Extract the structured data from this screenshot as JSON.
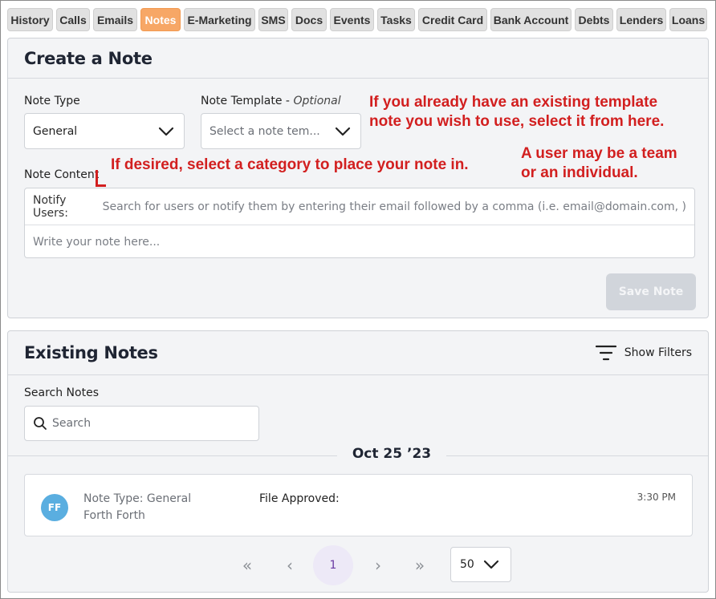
{
  "tabs": [
    {
      "label": "History"
    },
    {
      "label": "Calls"
    },
    {
      "label": "Emails"
    },
    {
      "label": "Notes",
      "active": true
    },
    {
      "label": "E-Marketing"
    },
    {
      "label": "SMS"
    },
    {
      "label": "Docs"
    },
    {
      "label": "Events"
    },
    {
      "label": "Tasks"
    },
    {
      "label": "Credit Card"
    },
    {
      "label": "Bank Account"
    },
    {
      "label": "Debts"
    },
    {
      "label": "Lenders"
    },
    {
      "label": "Loans"
    }
  ],
  "create_note": {
    "title": "Create a Note",
    "note_type_label": "Note Type",
    "note_type_value": "General",
    "note_template_label": "Note Template - ",
    "note_template_optional": "Optional",
    "note_template_placeholder": "Select a note tem...",
    "note_content_label": "Note Content",
    "notify_users_label": "Notify Users:",
    "notify_users_placeholder": "Search for users or notify them by entering their email followed by a comma (i.e. email@domain.com, )",
    "note_placeholder": "Write your note here...",
    "save_button": "Save Note"
  },
  "annotations": {
    "template_line1": "If you already have an existing template",
    "template_line2": "note you wish to use, select it from here.",
    "category": "If desired, select a category to place your note in.",
    "user_line1": "A user may be a team",
    "user_line2": "or an individual."
  },
  "existing_notes": {
    "title": "Existing Notes",
    "show_filters": "Show Filters",
    "search_label": "Search Notes",
    "search_placeholder": "Search",
    "date_header": "Oct 25 ’23",
    "notes": [
      {
        "avatar_initials": "FF",
        "note_type": "Note Type: General",
        "author": "Forth Forth",
        "field": "File Approved:",
        "time": "3:30 PM"
      }
    ]
  },
  "pagination": {
    "first": "«",
    "prev": "‹",
    "current_page": "1",
    "next": "›",
    "last": "»",
    "per_page": "50"
  },
  "colors": {
    "active_tab": "#f7a766",
    "annotation": "#d21f1f",
    "avatar": "#5aaee0",
    "current_page_bg": "#ede9f7"
  }
}
